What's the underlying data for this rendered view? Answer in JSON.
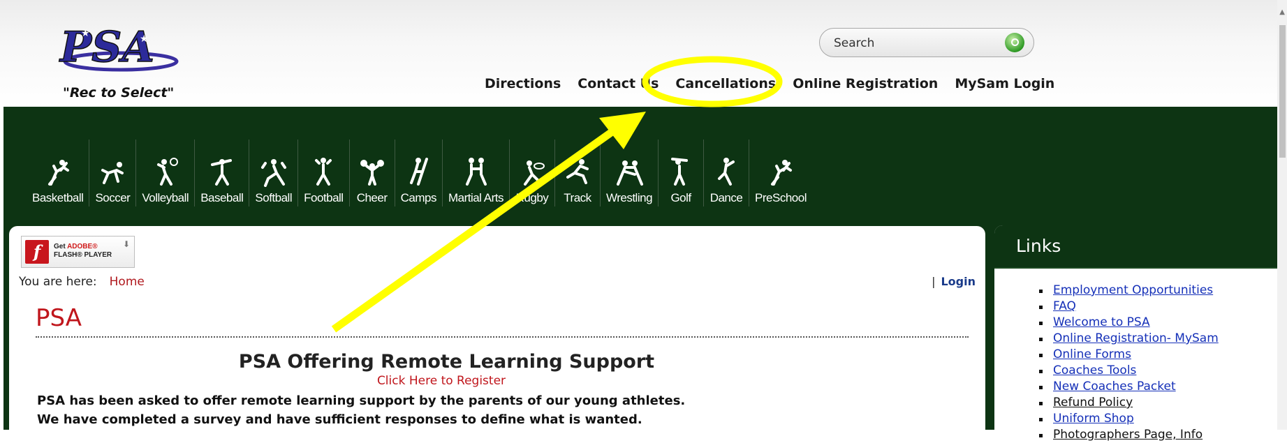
{
  "header": {
    "logo_text": "PSA",
    "tagline": "\"Rec to Select\"",
    "search_placeholder": "Search",
    "nav": [
      "Directions",
      "Contact Us",
      "Cancellations",
      "Online Registration",
      "MySam Login"
    ]
  },
  "sports": [
    "Basketball",
    "Soccer",
    "Volleyball",
    "Baseball",
    "Softball",
    "Football",
    "Cheer",
    "Camps",
    "Martial Arts",
    "Rugby",
    "Track",
    "Wrestling",
    "Golf",
    "Dance",
    "PreSchool"
  ],
  "flash": {
    "line1a": "Get ",
    "line1b": "ADOBE®",
    "line2": "FLASH® PLAYER"
  },
  "breadcrumb": {
    "label": "You are here:",
    "home": "Home"
  },
  "login": {
    "sep": "|",
    "label": "Login"
  },
  "page_title": "PSA",
  "article": {
    "title": "PSA Offering Remote Learning Support",
    "link": "Click Here to Register",
    "paragraphs": [
      "PSA has been asked to offer remote learning support by the parents of our young athletes.",
      "We have completed a survey and have sufficient responses to define what is wanted."
    ]
  },
  "sidebar": {
    "title": "Links",
    "links": [
      "Employment Opportunities",
      "FAQ",
      "Welcome to PSA",
      "Online Registration- MySam",
      "Online Forms",
      "Coaches Tools",
      "New Coaches Packet",
      "Refund Policy",
      "Uniform Shop",
      "Photographers Page, Info"
    ]
  },
  "colors": {
    "green": "#0d3413",
    "red": "#c0161c",
    "link": "#1530b8",
    "highlight": "#ffff00"
  }
}
